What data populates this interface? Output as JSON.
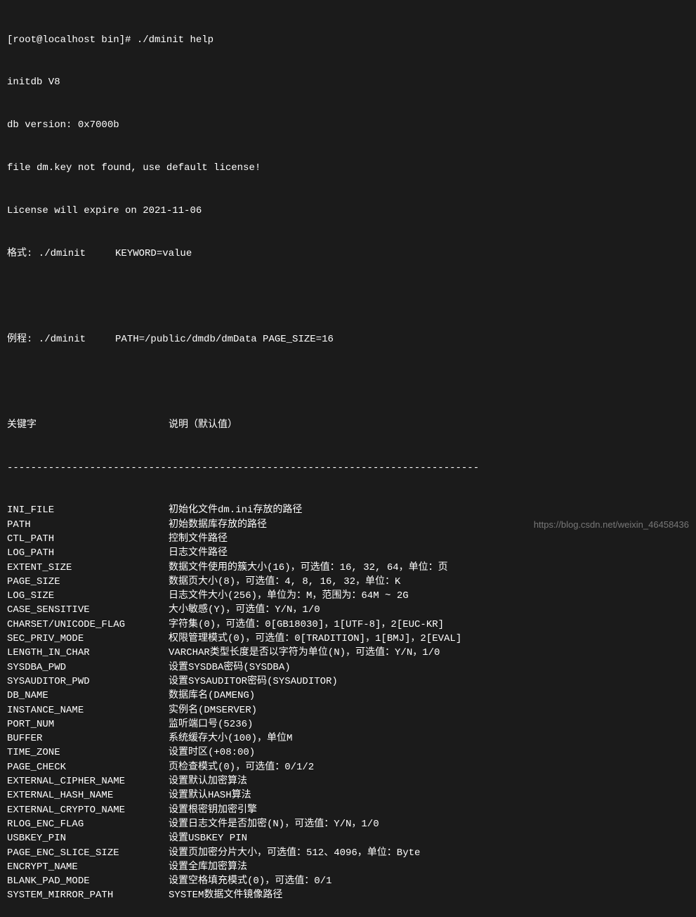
{
  "header": {
    "prompt": "[root@localhost bin]# ./dminit help",
    "line1": "initdb V8",
    "line2": "db version: 0x7000b",
    "line3": "file dm.key not found, use default license!",
    "line4": "License will expire on 2021-11-06",
    "line5": "格式: ./dminit     KEYWORD=value",
    "example": "例程: ./dminit     PATH=/public/dmdb/dmData PAGE_SIZE=16",
    "colhead_kw": "关键字",
    "colhead_desc": "说明（默认值）",
    "separator": "--------------------------------------------------------------------------------"
  },
  "params": [
    {
      "kw": "INI_FILE",
      "desc": "初始化文件dm.ini存放的路径"
    },
    {
      "kw": "PATH",
      "desc": "初始数据库存放的路径"
    },
    {
      "kw": "CTL_PATH",
      "desc": "控制文件路径"
    },
    {
      "kw": "LOG_PATH",
      "desc": "日志文件路径"
    },
    {
      "kw": "EXTENT_SIZE",
      "desc": "数据文件使用的簇大小(16)，可选值：16, 32, 64，单位：页"
    },
    {
      "kw": "PAGE_SIZE",
      "desc": "数据页大小(8)，可选值：4, 8, 16, 32，单位：K"
    },
    {
      "kw": "LOG_SIZE",
      "desc": "日志文件大小(256)，单位为：M，范围为：64M ~ 2G"
    },
    {
      "kw": "CASE_SENSITIVE",
      "desc": "大小敏感(Y)，可选值：Y/N，1/0"
    },
    {
      "kw": "CHARSET/UNICODE_FLAG",
      "desc": "字符集(0)，可选值：0[GB18030]，1[UTF-8]，2[EUC-KR]"
    },
    {
      "kw": "SEC_PRIV_MODE",
      "desc": "权限管理模式(0)，可选值：0[TRADITION]，1[BMJ]，2[EVAL]"
    },
    {
      "kw": "LENGTH_IN_CHAR",
      "desc": "VARCHAR类型长度是否以字符为单位(N)，可选值：Y/N，1/0"
    },
    {
      "kw": "SYSDBA_PWD",
      "desc": "设置SYSDBA密码(SYSDBA)"
    },
    {
      "kw": "SYSAUDITOR_PWD",
      "desc": "设置SYSAUDITOR密码(SYSAUDITOR)"
    },
    {
      "kw": "DB_NAME",
      "desc": "数据库名(DAMENG)"
    },
    {
      "kw": "INSTANCE_NAME",
      "desc": "实例名(DMSERVER)"
    },
    {
      "kw": "PORT_NUM",
      "desc": "监听端口号(5236)"
    },
    {
      "kw": "BUFFER",
      "desc": "系统缓存大小(100)，单位M"
    },
    {
      "kw": "TIME_ZONE",
      "desc": "设置时区(+08:00)"
    },
    {
      "kw": "PAGE_CHECK",
      "desc": "页检查模式(0)，可选值：0/1/2"
    },
    {
      "kw": "EXTERNAL_CIPHER_NAME",
      "desc": "设置默认加密算法"
    },
    {
      "kw": "EXTERNAL_HASH_NAME",
      "desc": "设置默认HASH算法"
    },
    {
      "kw": "EXTERNAL_CRYPTO_NAME",
      "desc": "设置根密钥加密引擎"
    },
    {
      "kw": "RLOG_ENC_FLAG",
      "desc": "设置日志文件是否加密(N)，可选值：Y/N，1/0"
    },
    {
      "kw": "USBKEY_PIN",
      "desc": "设置USBKEY PIN"
    },
    {
      "kw": "PAGE_ENC_SLICE_SIZE",
      "desc": "设置页加密分片大小，可选值：512、4096，单位：Byte"
    },
    {
      "kw": "ENCRYPT_NAME",
      "desc": "设置全库加密算法"
    },
    {
      "kw": "BLANK_PAD_MODE",
      "desc": "设置空格填充模式(0)，可选值：0/1"
    },
    {
      "kw": "SYSTEM_MIRROR_PATH",
      "desc": "SYSTEM数据文件镜像路径"
    }
  ],
  "watermark": "https://blog.csdn.net/weixin_46458436"
}
